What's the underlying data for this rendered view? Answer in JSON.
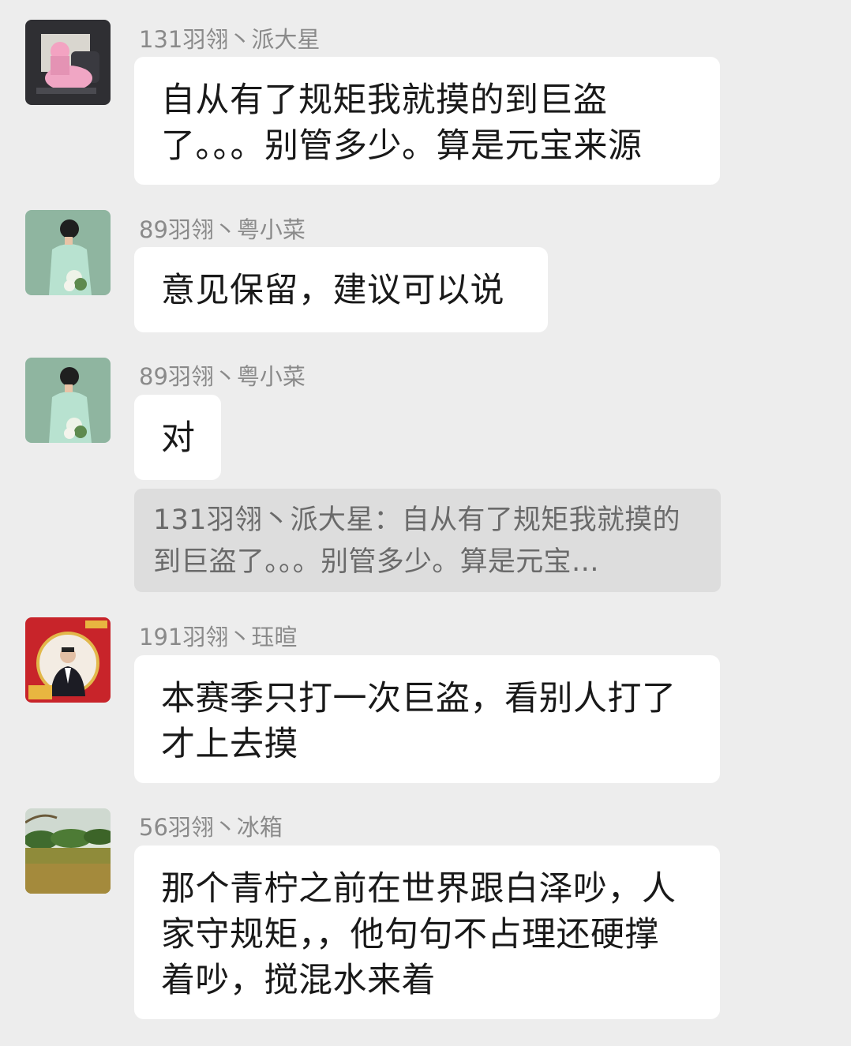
{
  "messages": [
    {
      "sender": "131羽翎丶派大星",
      "avatar_icon": "patrick-star-avatar",
      "text": "自从有了规矩我就摸的到巨盗了。。。别管多少。算是元宝来源"
    },
    {
      "sender": "89羽翎丶粤小菜",
      "avatar_icon": "man-with-flowers-avatar",
      "text": "意见保留，建议可以说"
    },
    {
      "sender": "89羽翎丶粤小菜",
      "avatar_icon": "man-with-flowers-avatar",
      "text": "对",
      "quote": "131羽翎丶派大星：自从有了规矩我就摸的到巨盗了。。。别管多少。算是元宝…"
    },
    {
      "sender": "191羽翎丶珏暄",
      "avatar_icon": "businessman-red-frame-avatar",
      "text": "本赛季只打一次巨盗，看别人打了才上去摸"
    },
    {
      "sender": "56羽翎丶冰箱",
      "avatar_icon": "park-landscape-avatar",
      "text": "那个青柠之前在世界跟白泽吵，人家守规矩，，他句句不占理还硬撑着吵，搅混水来着"
    }
  ],
  "colors": {
    "background": "#ededed",
    "bubble": "#ffffff",
    "quote_bg": "#dddddd",
    "sender_text": "#8a8a8a"
  }
}
